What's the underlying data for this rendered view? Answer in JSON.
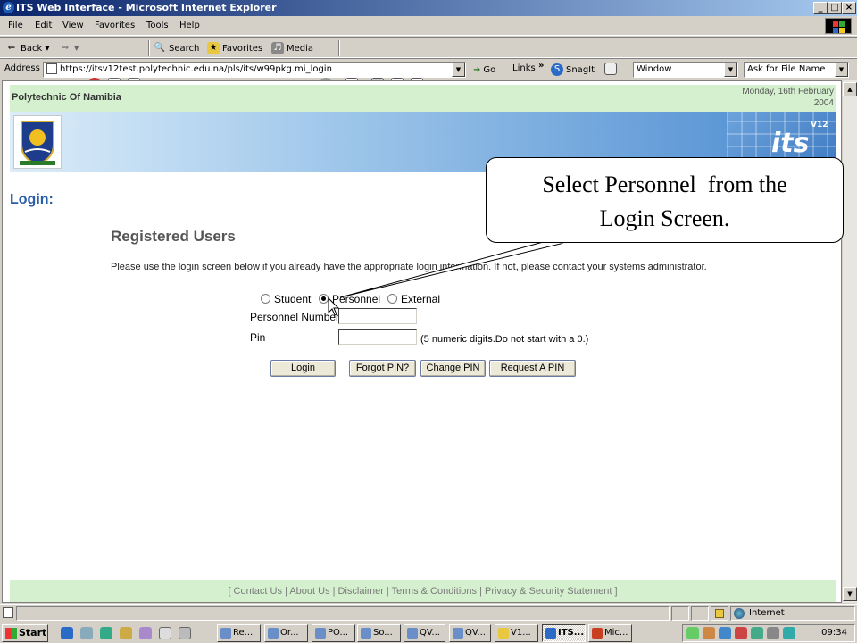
{
  "window": {
    "title": "ITS Web Interface - Microsoft Internet Explorer",
    "buttons": {
      "minimize": "_",
      "maximize": "□",
      "close": "×"
    }
  },
  "menu": [
    "File",
    "Edit",
    "View",
    "Favorites",
    "Tools",
    "Help"
  ],
  "toolbar": {
    "back": "Back",
    "search": "Search",
    "favorites": "Favorites",
    "media": "Media"
  },
  "address": {
    "label": "Address",
    "url": "https://itsv12test.polytechnic.edu.na/pls/its/w99pkg.mi_login",
    "go": "Go",
    "links": "Links",
    "snagit": "SnagIt",
    "window_select": "Window",
    "file_select": "Ask for File Name"
  },
  "page": {
    "institution": "Polytechnic Of Namibia",
    "date_line1": "Monday, 16th February",
    "date_line2": "2004",
    "logo_text": "its",
    "logo_version": "V12",
    "login_heading": "Login:",
    "section_title": "Registered Users",
    "intro": "Please use the login screen below if you already have the appropriate login information. If not, please contact your systems administrator.",
    "user_types": [
      "Student",
      "Personnel",
      "External"
    ],
    "selected_user_type": "Personnel",
    "personnel_number_label": "Personnel Number",
    "personnel_number_value": "",
    "pin_label": "Pin",
    "pin_value": "",
    "pin_hint": "(5 numeric digits.Do not start with a 0.)",
    "buttons": {
      "login": "Login",
      "forgot_pin": "Forgot PIN?",
      "change_pin": "Change PIN",
      "request_pin": "Request A PIN"
    },
    "footer": "[ Contact Us | About Us | Disclaimer | Terms & Conditions | Privacy & Security Statement ]"
  },
  "callout": {
    "line1": "Select Personnel  from the",
    "line2": "Login Screen."
  },
  "statusbar": {
    "zone": "Internet"
  },
  "taskbar": {
    "start": "Start",
    "tasks": [
      "Re...",
      "Or...",
      "PO...",
      "So...",
      "QV...",
      "QV...",
      "V1...",
      "ITS...",
      "Mic..."
    ],
    "active_task": "ITS...",
    "clock": "09:34"
  }
}
